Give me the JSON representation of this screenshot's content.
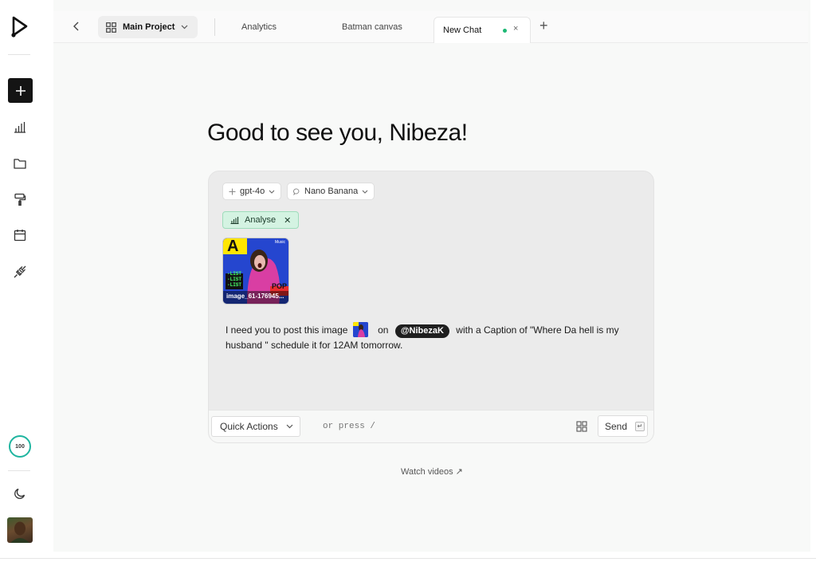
{
  "tabs": {
    "project_label": "Main Project",
    "items": [
      "Analytics",
      "Batman canvas"
    ],
    "active_label": "New Chat",
    "active_close": "×",
    "add_label": "+"
  },
  "greeting": "Good to see you, Nibeza!",
  "composer": {
    "model_label": "gpt-4o",
    "tool_label": "Nano Banana",
    "analyse_label": "Analyse",
    "attachment": {
      "filename": "image_61-176945...",
      "badge_music": "Music",
      "badge_letter": "A",
      "list_text": [
        "-LIST",
        "-LIST",
        "-LIST"
      ],
      "pop_text": "POP"
    },
    "message": {
      "part1": "I need you to post this image",
      "part2": "on",
      "mention": "@NibezaK",
      "part3": "with a Caption of \"Where Da hell is my husband \" schedule it for 12AM tomorrow."
    },
    "quick_actions_label": "Quick Actions",
    "press_hint": "or press /",
    "send_label": "Send",
    "send_key": "↵"
  },
  "credits": "100",
  "watch_videos": "Watch videos ↗",
  "colors": {
    "accent_green": "#1cb874",
    "credits_ring": "#1fb5a0",
    "analyse_bg": "#d4f3e2"
  }
}
